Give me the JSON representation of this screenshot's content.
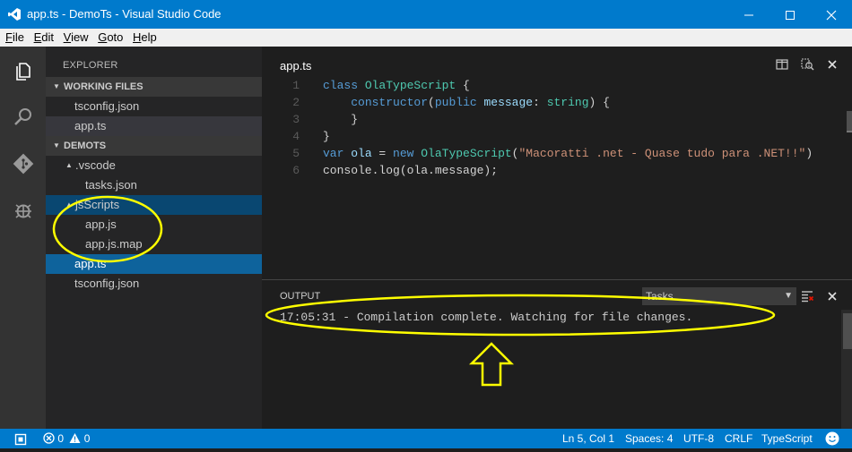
{
  "window": {
    "title": "app.ts - DemoTs - Visual Studio Code"
  },
  "menu": [
    "File",
    "Edit",
    "View",
    "Goto",
    "Help"
  ],
  "activity_bar": {
    "icons": [
      "files-icon",
      "search-icon",
      "git-icon",
      "debug-icon"
    ]
  },
  "sidebar": {
    "title": "EXPLORER",
    "working_files": {
      "label": "WORKING FILES",
      "items": [
        "tsconfig.json",
        "app.ts"
      ]
    },
    "project": {
      "label": "DEMOTS",
      "vscode_folder": ".vscode",
      "vscode_items": [
        "tasks.json"
      ],
      "jsscripts_folder": "jsScripts",
      "jsscripts_items": [
        "app.js",
        "app.js.map"
      ],
      "root_items": [
        "app.ts",
        "tsconfig.json"
      ]
    }
  },
  "editor": {
    "filename": "app.ts",
    "line_numbers": [
      "1",
      "2",
      "3",
      "4",
      "5",
      "6"
    ],
    "lines": [
      [
        {
          "t": "class ",
          "c": "kw"
        },
        {
          "t": "OlaTypeScript",
          "c": "cls"
        },
        {
          "t": " {",
          "c": ""
        }
      ],
      [
        {
          "t": "    ",
          "c": ""
        },
        {
          "t": "constructor",
          "c": "kw"
        },
        {
          "t": "(",
          "c": ""
        },
        {
          "t": "public ",
          "c": "kw"
        },
        {
          "t": "message",
          "c": "prm"
        },
        {
          "t": ": ",
          "c": ""
        },
        {
          "t": "string",
          "c": "cls"
        },
        {
          "t": ") {",
          "c": ""
        }
      ],
      [
        {
          "t": "    }",
          "c": ""
        }
      ],
      [
        {
          "t": "}",
          "c": ""
        }
      ],
      [
        {
          "t": "var ",
          "c": "kw"
        },
        {
          "t": "ola",
          "c": "prm"
        },
        {
          "t": " = ",
          "c": ""
        },
        {
          "t": "new ",
          "c": "kw"
        },
        {
          "t": "OlaTypeScript",
          "c": "cls"
        },
        {
          "t": "(",
          "c": ""
        },
        {
          "t": "\"Macoratti .net - Quase tudo para .NET!!\"",
          "c": "str"
        },
        {
          "t": ")",
          "c": ""
        }
      ],
      [
        {
          "t": "console.log(ola.message);",
          "c": ""
        }
      ]
    ]
  },
  "panel": {
    "title": "OUTPUT",
    "channel": "Tasks",
    "output": "17:05:31 - Compilation complete. Watching for file changes."
  },
  "status": {
    "errors": "0",
    "warnings": "0",
    "position": "Ln 5, Col 1",
    "spaces": "Spaces: 4",
    "encoding": "UTF-8",
    "eol": "CRLF",
    "language": "TypeScript"
  },
  "colors": {
    "accent": "#007acc",
    "annotation": "#ffff00"
  }
}
